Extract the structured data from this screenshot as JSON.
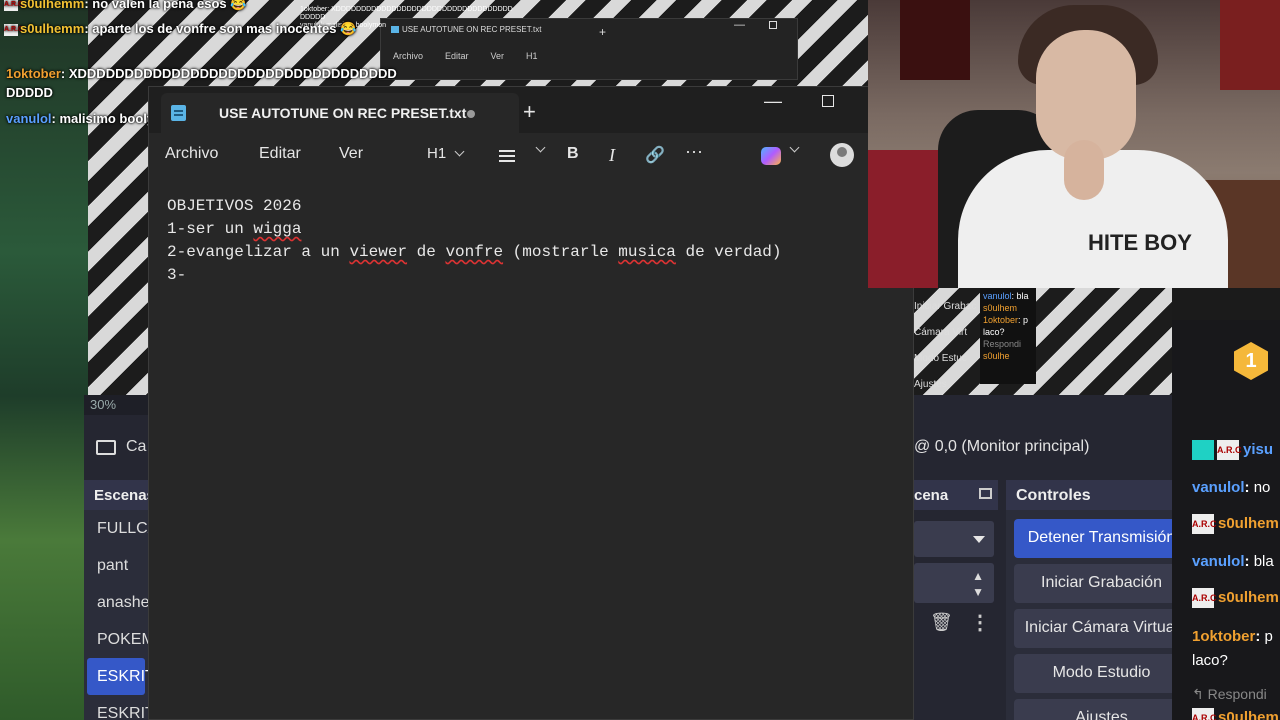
{
  "chat_overlay": {
    "lines": [
      {
        "user": "s0ulhemm",
        "text": "no valen la pena esos"
      },
      {
        "user": "s0ulhemm",
        "text": "aparte los de vonfre son mas inocentes"
      },
      {
        "user": "1oktober",
        "text": "XDDDDDDDDDDDDDDDDDDDDDDDDDDDDDDDDDD"
      },
      {
        "user": "",
        "text": "DDDDD"
      },
      {
        "user": "vanulol",
        "text": "malisimo boolymon"
      }
    ],
    "badge": "A.R.C"
  },
  "tiny_chat": {
    "line1": "1oktober: XDDDDDDDDDDDDDDDDDDDDDDDDDDDDDDDDDDD",
    "line2": "DDDDD",
    "line3": "vanulol: malisimo boolymon"
  },
  "small_notepad": {
    "tab_title": "USE AUTOTUNE ON REC PRESET.txt",
    "menu": [
      "Archivo",
      "Editar",
      "Ver",
      "H1"
    ]
  },
  "notepad": {
    "tab_title": "USE AUTOTUNE ON REC PRESET.txt",
    "menu": {
      "file": "Archivo",
      "edit": "Editar",
      "view": "Ver"
    },
    "heading_select": "H1",
    "bold": "B",
    "italic": "I",
    "more": "···",
    "plus": "+",
    "minimize": "—",
    "lines": {
      "l1": "OBJETIVOS 2026",
      "l2a": "1-ser un ",
      "l2b": "wigga",
      "l3a": "2-evangelizar a un ",
      "l3b": "viewer",
      "l3c": " de ",
      "l3d": "vonfre",
      "l3e": " (mostrarle ",
      "l3f": "musica",
      "l3g": " de verdad)",
      "l4": "3-"
    }
  },
  "obs": {
    "zoom": "30%",
    "camera_label": "Ca",
    "scenes_title": "Escenas",
    "scenes": [
      "FULLCAM",
      "pant",
      "anashe",
      "POKEMON",
      "ESKRITORIO",
      "ESKRIT"
    ],
    "active_scene_index": 4,
    "monitor_label": "@ 0,0 (Monitor principal)",
    "sources_title": "cena",
    "controls_title": "Controles",
    "controls": [
      "Detener Transmisión",
      "Iniciar Grabación",
      "Iniciar Cámara Virtual",
      "Modo Estudio",
      "Ajustes"
    ]
  },
  "mini_obs": {
    "items": [
      "Iniciar Grabac",
      "Cámara Virt",
      "Modo Estuc",
      "Ajustes"
    ],
    "chat": [
      {
        "user": "vanulol",
        "text": "bla"
      },
      {
        "user": "s0ulhem",
        "text": ""
      },
      {
        "user": "1oktober",
        "text": "p laco?"
      },
      {
        "user": "",
        "text": "Respondi"
      },
      {
        "user": "s0ulhe",
        "text": ""
      }
    ]
  },
  "right_chat": {
    "badge_number": "1",
    "lines": [
      {
        "user": "yisu",
        "text": ""
      },
      {
        "user": "vanulol",
        "text": "no"
      },
      {
        "user": "s0ulhem",
        "text": ""
      },
      {
        "user": "vanulol",
        "text": "bla"
      },
      {
        "user": "s0ulhem",
        "text": ""
      },
      {
        "user": "1oktober",
        "text": "p"
      },
      {
        "user": "",
        "text": "laco?"
      }
    ],
    "reply_label": "Respondi",
    "last_user": "s0ulhem"
  },
  "webcam": {
    "shirt_text": "HITE BOY"
  },
  "colors": {
    "accent_blue": "#3558c8",
    "user_orange": "#f0a030",
    "user_blue": "#5aa0ff",
    "notepad_bg": "#272727"
  }
}
